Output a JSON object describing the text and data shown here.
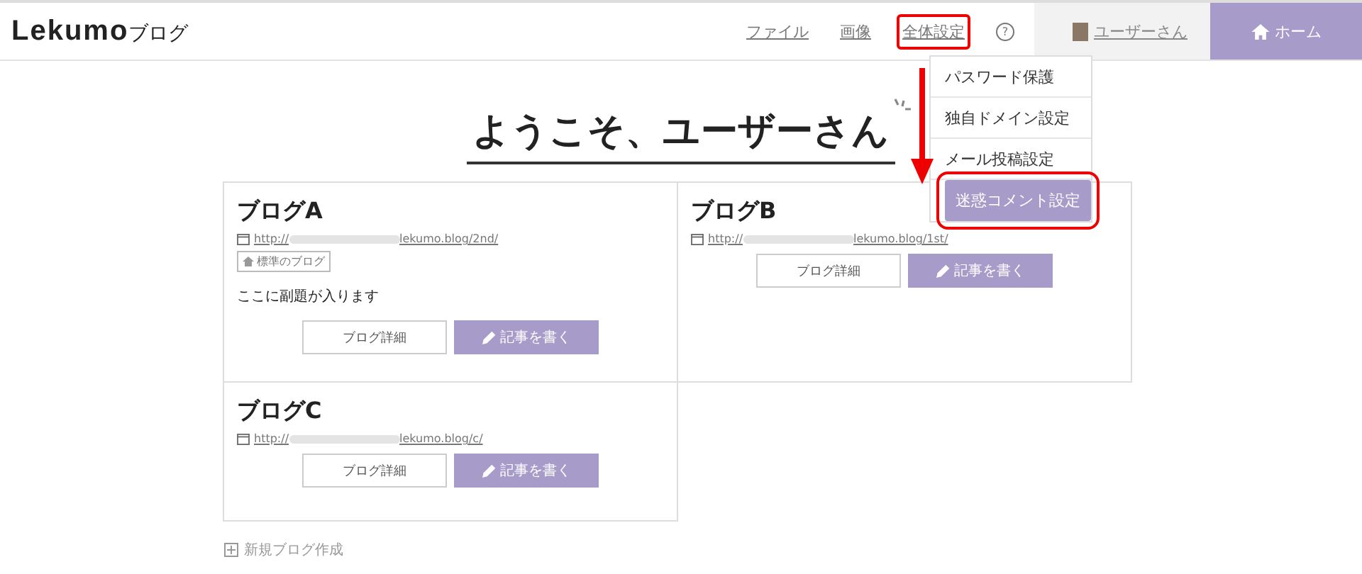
{
  "header": {
    "logo": "Lekumo",
    "logo_suffix": "ブログ",
    "nav": [
      {
        "label": "ファイル",
        "annotated": false
      },
      {
        "label": "画像",
        "annotated": false
      },
      {
        "label": "全体設定",
        "annotated": true
      }
    ],
    "help": "?",
    "user": "ユーザーさん",
    "home": "ホーム"
  },
  "menu": {
    "items": [
      {
        "label": "パスワード保護",
        "selected": false,
        "annotated": false
      },
      {
        "label": "独自ドメイン設定",
        "selected": false,
        "annotated": false
      },
      {
        "label": "メール投稿設定",
        "selected": false,
        "annotated": false
      },
      {
        "label": "迷惑コメント設定",
        "selected": true,
        "annotated": true
      }
    ]
  },
  "title": "ようこそ、ユーザーさん",
  "blogs": [
    {
      "name": "ブログA",
      "url_start": "http://",
      "url_end": "lekumo.blog/2nd/",
      "badge": "標準のブログ",
      "subtitle": "ここに副題が入ります",
      "detail": "ブログ詳細",
      "write": "記事を書く"
    },
    {
      "name": "ブログB",
      "url_start": "http://",
      "url_end": "lekumo.blog/1st/",
      "detail": "ブログ詳細",
      "write": "記事を書く"
    },
    {
      "name": "ブログC",
      "url_start": "http://",
      "url_end": "lekumo.blog/c/",
      "detail": "ブログ詳細",
      "write": "記事を書く"
    }
  ],
  "new_blog": "新規ブログ作成"
}
